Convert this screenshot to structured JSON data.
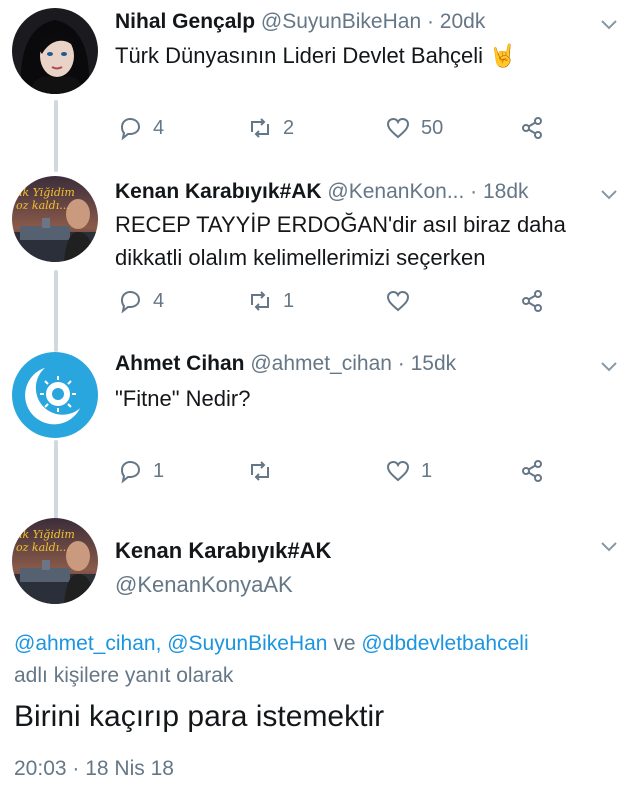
{
  "tweets": [
    {
      "name": "Nihal Gençalp",
      "meta": "@SuyunBikeHan · 20dk",
      "text": "Türk Dünyasının Lideri Devlet Bahçeli 🤘",
      "replies": "4",
      "retweets": "2",
      "likes": "50"
    },
    {
      "name": "Kenan Karabıyık#AK",
      "meta": "@KenanKon... · 18dk",
      "text": "RECEP TAYYİP ERDOĞAN'dir asıl biraz daha dikkatli olalım kelimellerimizi seçerken",
      "replies": "4",
      "retweets": "1",
      "likes": ""
    },
    {
      "name": "Ahmet Cihan",
      "meta": "@ahmet_cihan · 15dk",
      "text": "\"Fitne\" Nedir?",
      "replies": "1",
      "retweets": "",
      "likes": "1"
    }
  ],
  "main": {
    "name": "Kenan Karabıyık#AK",
    "handle": "@KenanKonyaAK",
    "reply_mentions": "@ahmet_cihan, @SuyunBikeHan",
    "reply_and": " ve ",
    "reply_mention_last": "@dbdevletbahceli",
    "reply_suffix": "adlı kişilere yanıt olarak",
    "text": "Birini kaçırıp para istemektir",
    "timestamp": "20:03 · 18 Nis 18"
  },
  "avatar_caption": {
    "line1": "ak Yiğidim",
    "line2": "oz kaldı..."
  },
  "colors": {
    "accent": "#1b95e0",
    "muted": "#657786",
    "line": "#cfd9de",
    "emblem_bg": "#2aa6df"
  }
}
